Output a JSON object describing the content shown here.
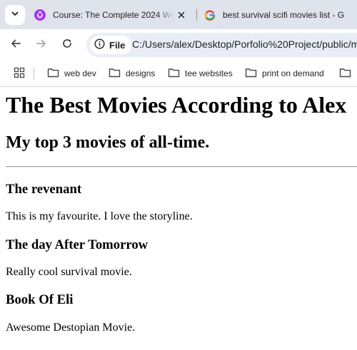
{
  "colors": {
    "tab_strip_bg": "#dfe3eb",
    "omnibox_bg": "#e9eef6",
    "udemy_purple": "#a435f0"
  },
  "browser": {
    "tabs": [
      {
        "title": "Course: The Complete 2024 We",
        "icon": "udemy-icon",
        "close_icon": "close-icon"
      },
      {
        "title": "best survival scifi movies list - G",
        "icon": "google-icon",
        "close_icon": "close-icon"
      }
    ],
    "tab_search_icon": "chevron-down-icon",
    "nav": {
      "back_icon": "back-arrow-icon",
      "forward_icon": "forward-arrow-icon",
      "reload_icon": "reload-icon"
    },
    "omnibox": {
      "scheme_label": "File",
      "url": "C:/Users/alex/Desktop/Porfolio%20Project/public/m"
    },
    "bookmarks": [
      {
        "label": "web dev"
      },
      {
        "label": "designs"
      },
      {
        "label": "tee websites"
      },
      {
        "label": "print on demand"
      },
      {
        "label": ""
      }
    ]
  },
  "page": {
    "title": "The Best Movies According to Alex",
    "subtitle": "My top 3 movies of all-time.",
    "movies": [
      {
        "title": "The revenant",
        "description": "This is my favourite. I love the storyline."
      },
      {
        "title": "The day After Tomorrow",
        "description": "Really cool survival movie."
      },
      {
        "title": "Book Of Eli",
        "description": "Awesome Destopian Movie."
      }
    ]
  }
}
